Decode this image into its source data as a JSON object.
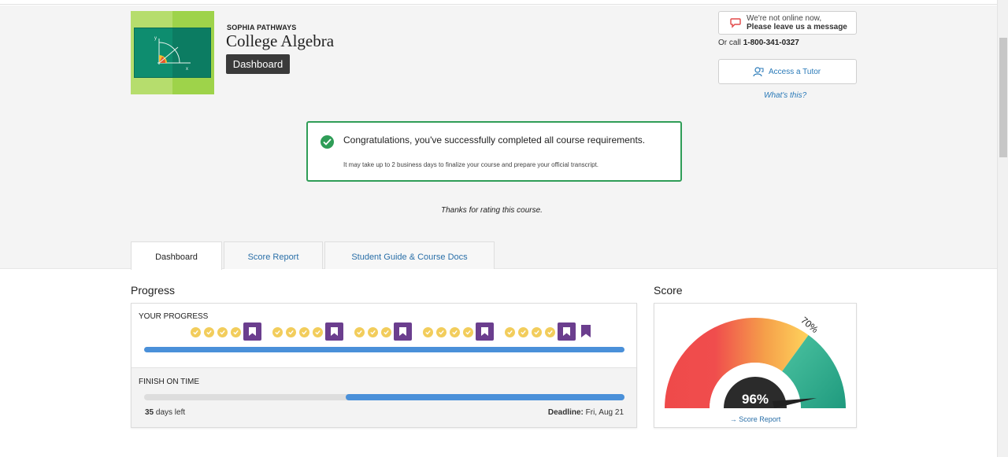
{
  "header": {
    "program": "SOPHIA PATHWAYS",
    "course_title": "College Algebra",
    "dashboard_chip": "Dashboard"
  },
  "contact": {
    "chat_line1": "We're not online now,",
    "chat_line2": "Please leave us a message",
    "call_prefix": "Or call",
    "phone": "1-800-341-0327",
    "tutor_label": "Access a Tutor",
    "whats_this": "What's this?"
  },
  "notice": {
    "title": "Congratulations, you've successfully completed all course requirements.",
    "subtitle": "It may take up to 2 business days to finalize your course and prepare your official transcript.",
    "thanks": "Thanks for rating this course."
  },
  "tabs": [
    {
      "label": "Dashboard",
      "active": true
    },
    {
      "label": "Score Report",
      "active": false
    },
    {
      "label": "Student Guide & Course Docs",
      "active": false
    }
  ],
  "progress": {
    "section_title": "Progress",
    "your_progress_label": "YOUR PROGRESS",
    "progress_fraction": 1.0,
    "milestone_groups": [
      {
        "checks": 4,
        "flag": true
      },
      {
        "checks": 4,
        "flag": true
      },
      {
        "checks": 3,
        "flag": true
      },
      {
        "checks": 4,
        "flag": true
      },
      {
        "checks": 4,
        "flag": true
      }
    ],
    "final_flag": true,
    "finish_on_time_label": "FINISH ON TIME",
    "days_left_value": "35",
    "days_left_suffix": "days left",
    "deadline_label": "Deadline:",
    "deadline_value": "Fri, Aug 21",
    "time_elapsed_fraction": 0.42
  },
  "score": {
    "section_title": "Score",
    "value": "96%",
    "threshold": "70%",
    "link": "→ Score Report",
    "colors": {
      "low": "#ef4a4a",
      "mid": "#f5a04a",
      "high": "#ffd35c",
      "pass": "#2aa489",
      "needle": "#222222"
    }
  },
  "colors": {
    "accent_blue": "#4a90d9",
    "link_blue": "#2a6fa8",
    "success_green": "#2f9d57",
    "milestone_yellow": "#f2cd5c",
    "flag_purple": "#6b3e8e"
  }
}
